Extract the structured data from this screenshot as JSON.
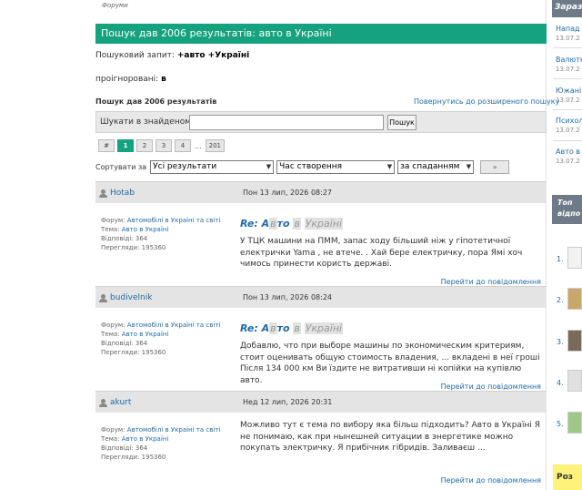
{
  "breadcrumb": "Форуми",
  "page_title": "Пошук дав 2006 результатів:  авто в Україні",
  "query": {
    "label": "Пошуковий запит:",
    "value": "+авто +Україні"
  },
  "ignored": {
    "label": "проігноровані:",
    "value": "в"
  },
  "results_count": "Пошук дав 2006 результатів",
  "back_link": "Повернутись до розширеного пошуку",
  "search_in": {
    "label": "Шукати в знайденому:",
    "value": "",
    "button": "Пошук"
  },
  "pager": {
    "hash": "#",
    "pages": [
      "1",
      "2",
      "3",
      "4"
    ],
    "ellipsis": "...",
    "last": "201"
  },
  "sort": {
    "label": "Сортувати за",
    "filter": "Усі результати",
    "by": "Час створення",
    "order": "за спаданням",
    "go": "»"
  },
  "results": [
    {
      "user": "Hotab",
      "date": "Пон 13 лип, 2026 08:27",
      "forum_label": "Форум:",
      "forum": "Автомобілі в Україні та світі",
      "topic_label": "Тема:",
      "topic": "Авто в Україні",
      "replies": "Відповіді: 364",
      "views": "Перегляди: 195360",
      "title_prefix": "Re: А",
      "title_hl1": "в",
      "title_mid": "то ",
      "title_hl2": "в",
      "title_hl3": "Україні",
      "text": "У ТЦК машини на ПММ, запас ходу більший ніж у гіпотетичної електрички Yama , не втече. . Хай бере електричку, пора Ямі хоч чимось принести користь державі.",
      "goto": "Перейти до повідомлення"
    },
    {
      "user": "budivelnik",
      "date": "Пон 13 лип, 2026 08:24",
      "forum_label": "Форум:",
      "forum": "Автомобілі в Україні та світі",
      "topic_label": "Тема:",
      "topic": "Авто в Україні",
      "replies": "Відповіді: 364",
      "views": "Перегляди: 195360",
      "title_prefix": "Re: А",
      "title_hl1": "в",
      "title_mid": "то ",
      "title_hl2": "в",
      "title_hl3": "Україні",
      "text": "Добавлю, что при выборе машины по экономическим критериям, стоит оценивать общую стоимость владения, ... вкладені в неї гроші Після 134 000 км Ви їздите не витративши ні копійки на купівлю авто.",
      "goto": "Перейти до повідомлення"
    },
    {
      "user": "akurt",
      "date": "Нед 12 лип, 2026 20:31",
      "forum_label": "Форум:",
      "forum": "Автомобілі в Україні та світі",
      "topic_label": "Тема:",
      "topic": "Авто в Україні",
      "replies": "Відповіді: 364",
      "views": "Перегляди: 195360",
      "text": "Можливо тут є тема по вибору яка більш підходить? Авто в Україні Я не понимаю, как при нынешней ситуации в энергетике можно покупать электричку. Я прибічник гібридів. Заливаєш ...",
      "goto": "Перейти до повідомлення"
    }
  ],
  "sidebar": {
    "header": "Зараз",
    "items": [
      {
        "title": "Напад н",
        "date": "13.07.2"
      },
      {
        "title": "Валютн",
        "date": "13.07.2"
      },
      {
        "title": "Южаніі",
        "date": "13.07.2"
      },
      {
        "title": "Психол",
        "date": "13.07.2"
      },
      {
        "title": "Авто в",
        "date": "13.07.2"
      }
    ],
    "top_header_line1": "Топ",
    "top_header_line2": "відпо",
    "top_numbers": [
      "1.",
      "2.",
      "3.",
      "4.",
      "5."
    ],
    "bottom": "Роз"
  }
}
